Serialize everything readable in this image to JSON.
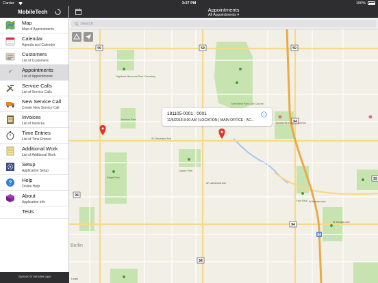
{
  "status_bar": {
    "carrier": "Carrier",
    "time": "3:27 PM",
    "battery": "100%"
  },
  "sidebar": {
    "app_title": "MobileTech",
    "footer": "Synced 5 minutes ago",
    "items": [
      {
        "title": "Map",
        "subtitle": "Map of Appointments",
        "icon": "map-icon"
      },
      {
        "title": "Calendar",
        "subtitle": "Agenda and Calender",
        "icon": "calendar-icon"
      },
      {
        "title": "Customers",
        "subtitle": "List of Customers",
        "icon": "customers-icon"
      },
      {
        "title": "Appointments",
        "subtitle": "List of Appointments",
        "icon": "check-icon"
      },
      {
        "title": "Service Calls",
        "subtitle": "List of Service Calls",
        "icon": "tools-icon"
      },
      {
        "title": "New Service Call",
        "subtitle": "Create New Service Call",
        "icon": "truck-icon"
      },
      {
        "title": "Invoices",
        "subtitle": "List of Invoices",
        "icon": "invoice-icon"
      },
      {
        "title": "Time Entries",
        "subtitle": "List of Time Entries",
        "icon": "stopwatch-icon"
      },
      {
        "title": "Additional Work",
        "subtitle": "List of Additional Work",
        "icon": "notepad-icon"
      },
      {
        "title": "Setup",
        "subtitle": "Application Setup",
        "icon": "setup-icon"
      },
      {
        "title": "Help",
        "subtitle": "Online Help",
        "icon": "help-icon"
      },
      {
        "title": "About",
        "subtitle": "Application Info",
        "icon": "about-icon"
      },
      {
        "title": "Tests",
        "subtitle": "",
        "icon": ""
      }
    ]
  },
  "topbar": {
    "title": "Appointments",
    "subtitle": "All Appointments ▾"
  },
  "search": {
    "placeholder": "Search"
  },
  "callout": {
    "title": "181105-0001 : 0001",
    "subtitle": "11/5/2018 8:00 AM | LOCATION | MAIN OFFICE - AC..."
  },
  "map": {
    "labels": {
      "ave_a": "W Cleveland Ave",
      "ave_b": "W Lakewood Ave",
      "ave_c": "W Arizona Ave",
      "ave_d": "W Morgan Ave",
      "park_a": "Greenfield Park Golf Course",
      "park_b": "Regal Park",
      "park_c": "Hoit Park",
      "cemetery": "Highland Memorial Park Cemetery",
      "hospital": "Aurora St. Luke's Hospital",
      "park_d": "Layton Park",
      "park_e": "Jackson Park",
      "town": "Berlin",
      "legal": "Legal",
      "shields": [
        "59",
        "94",
        "94",
        "59",
        "59",
        "59",
        "94",
        "94",
        "94"
      ]
    }
  },
  "colors": {
    "bar": "#2e2e30",
    "map_bg": "#f2efe6",
    "park": "#c7e4b0",
    "major_road": "#f7d98a",
    "minor_road": "#ffffff",
    "water": "#a6c8ef",
    "pin": "#e0332a",
    "selected_row": "#dcdcdf",
    "highway_blue": "#5a8fd8"
  }
}
